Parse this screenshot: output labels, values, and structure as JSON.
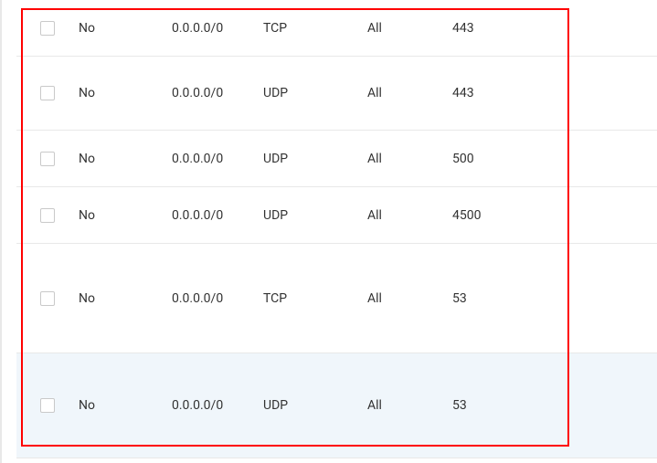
{
  "rules": [
    {
      "stateless": "No",
      "source": "0.0.0.0/0",
      "protocol": "TCP",
      "src_port": "All",
      "dst_port": "443"
    },
    {
      "stateless": "No",
      "source": "0.0.0.0/0",
      "protocol": "UDP",
      "src_port": "All",
      "dst_port": "443"
    },
    {
      "stateless": "No",
      "source": "0.0.0.0/0",
      "protocol": "UDP",
      "src_port": "All",
      "dst_port": "500"
    },
    {
      "stateless": "No",
      "source": "0.0.0.0/0",
      "protocol": "UDP",
      "src_port": "All",
      "dst_port": "4500"
    },
    {
      "stateless": "No",
      "source": "0.0.0.0/0",
      "protocol": "TCP",
      "src_port": "All",
      "dst_port": "53"
    },
    {
      "stateless": "No",
      "source": "0.0.0.0/0",
      "protocol": "UDP",
      "src_port": "All",
      "dst_port": "53"
    }
  ]
}
